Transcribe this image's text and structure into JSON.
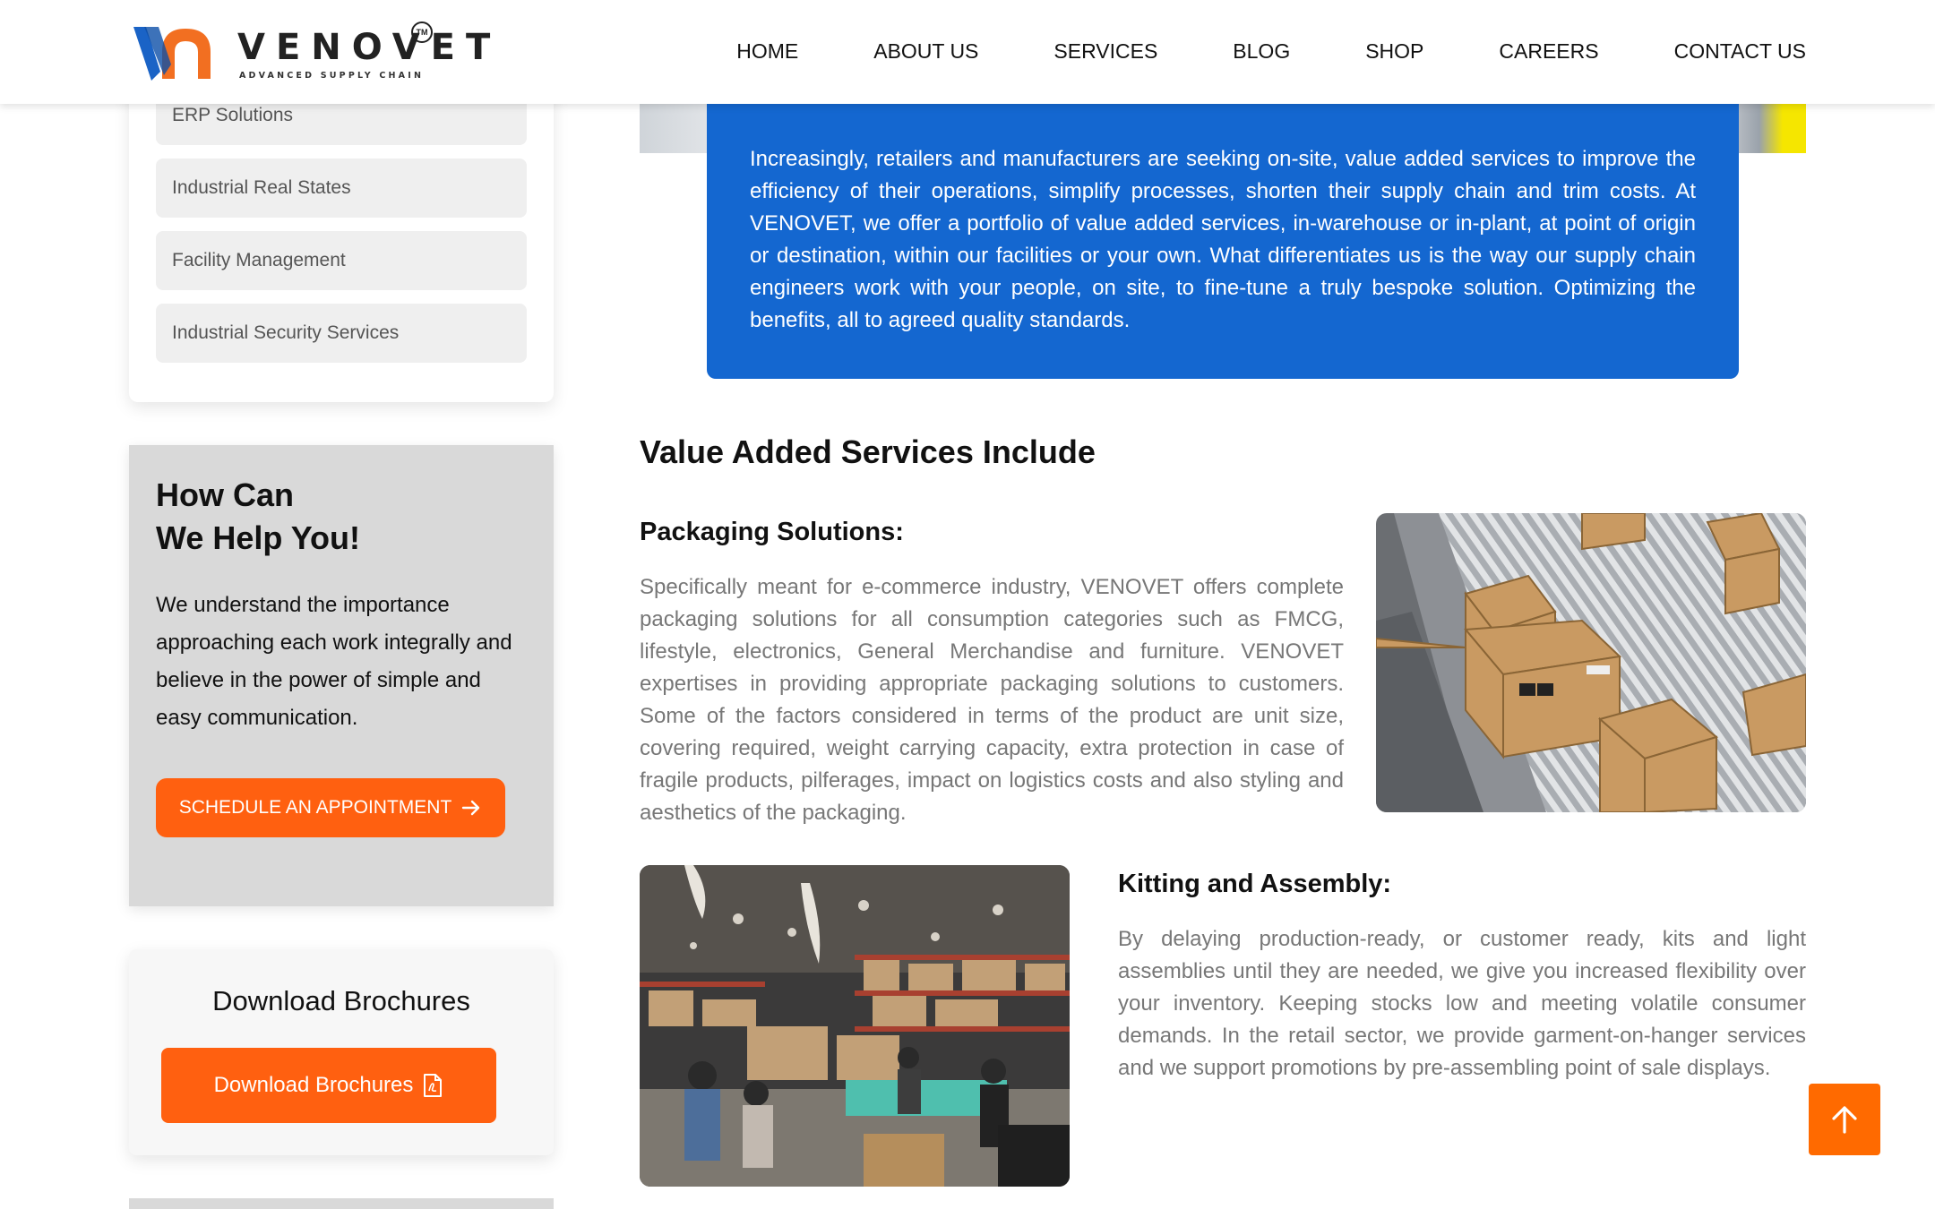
{
  "brand": {
    "name": "VENOVET",
    "tagline": "ADVANCED SUPPLY CHAIN",
    "trademark": "TM",
    "colors": {
      "blue": "#1467d0",
      "orange": "#ff6010",
      "logo_blue": "#1a63c6",
      "logo_orange": "#f26f21"
    }
  },
  "nav": {
    "items": [
      {
        "label": "HOME"
      },
      {
        "label": "ABOUT US"
      },
      {
        "label": "SERVICES"
      },
      {
        "label": "BLOG"
      },
      {
        "label": "SHOP"
      },
      {
        "label": "CAREERS"
      },
      {
        "label": "CONTACT US"
      }
    ]
  },
  "sidebar": {
    "services": [
      {
        "label": "ERP Solutions"
      },
      {
        "label": "Industrial Real States"
      },
      {
        "label": "Facility Management"
      },
      {
        "label": "Industrial Security Services"
      }
    ],
    "help": {
      "title_line1": "How Can",
      "title_line2": "We Help You!",
      "text": "We understand the importance approaching each work integrally and believe in the power of simple and easy communication.",
      "button_label": "SCHEDULE AN APPOINTMENT",
      "button_icon": "arrow-right-icon"
    },
    "brochures": {
      "title": "Download Brochures",
      "button_label": "Download Brochures",
      "button_icon": "pdf-file-icon"
    }
  },
  "main": {
    "intro": "Increasingly, retailers and manufacturers are seeking on-site, value added services to improve the efficiency of their operations, simplify processes, shorten their supply chain and trim costs. At VENOVET, we offer a portfolio of value added services, in-warehouse or in-plant, at point of origin or destination, within our facilities or your own. What differentiates us is the way our supply chain engineers work with your people, on site, to fine-tune a truly bespoke solution. Optimizing the benefits, all to agreed quality standards.",
    "section_title": "Value Added Services Include",
    "packaging": {
      "title": "Packaging Solutions:",
      "text": "Specifically meant for e-commerce industry, VENOVET offers complete packaging solutions for all consumption categories such as FMCG, lifestyle, electronics, General Merchandise and furniture. VENOVET expertises in providing appropriate packaging solutions to customers. Some of the factors considered in terms of the product are unit size, covering required, weight carrying capacity, extra protection in case of fragile products, pilferages, impact on logistics costs and also styling and aesthetics of the packaging.",
      "image": "boxes-on-conveyor-photo"
    },
    "kitting": {
      "title": "Kitting and Assembly:",
      "text": "By delaying production-ready, or customer ready, kits and light assemblies until they are needed, we give you increased flexibility over your inventory. Keeping stocks low and meeting volatile consumer demands. In the retail sector, we provide garment-on-hanger services and we support promotions by pre-assembling point of sale displays.",
      "image": "warehouse-workers-photo"
    }
  },
  "scroll_top": {
    "icon": "arrow-up-icon"
  }
}
